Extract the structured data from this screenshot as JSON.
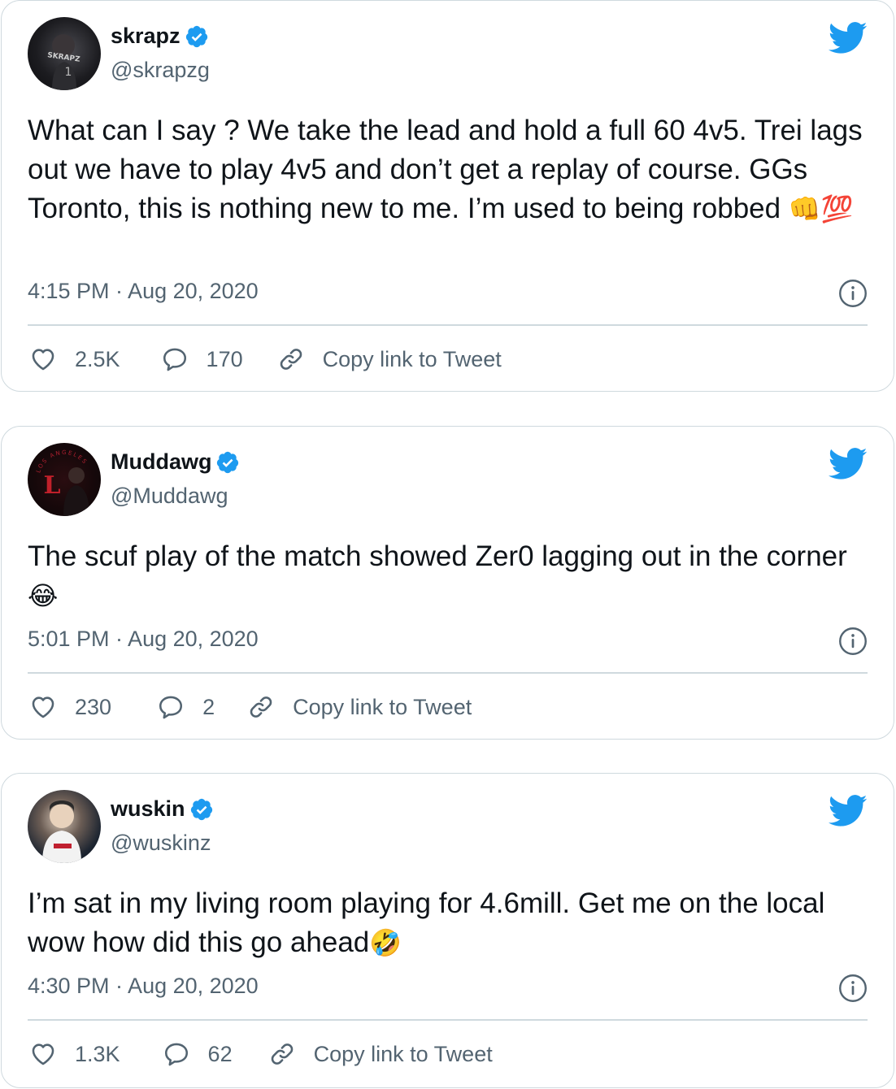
{
  "tweets": [
    {
      "name": "skrapz",
      "handle": "@skrapzg",
      "avatar_text": "SKRAPZ",
      "text": "What can I say ? We take the lead and hold a full 60 4v5. Trei lags out we have to play 4v5 and don’t get a replay of course. GGs Toronto, this is nothing new to me. I’m used to being robbed",
      "emoji": "👊💯",
      "time": "4:15 PM · Aug 20, 2020",
      "likes": "2.5K",
      "replies": "170",
      "copy_link": "Copy link to Tweet"
    },
    {
      "name": "Muddawg",
      "handle": "@Muddawg",
      "avatar_text": "LOS ANGELES",
      "text": "The scuf play of the match showed Zer0 lagging out in the corner",
      "emoji": "😂",
      "time": "5:01 PM · Aug 20, 2020",
      "likes": "230",
      "replies": "2",
      "copy_link": "Copy link to Tweet"
    },
    {
      "name": "wuskin",
      "handle": "@wuskinz",
      "text": "I’m sat in my living room playing for 4.6mill. Get me on the local wow how did this go ahead",
      "emoji": "🤣",
      "time": "4:30 PM · Aug 20, 2020",
      "likes": "1.3K",
      "replies": "62",
      "copy_link": "Copy link to Tweet"
    }
  ],
  "colors": {
    "twitter_blue": "#1d9bf0",
    "secondary_text": "#536471",
    "border": "#cfd9de"
  },
  "icons": [
    "verified-badge-icon",
    "twitter-bird-icon",
    "info-icon",
    "heart-icon",
    "reply-bubble-icon",
    "link-icon"
  ]
}
